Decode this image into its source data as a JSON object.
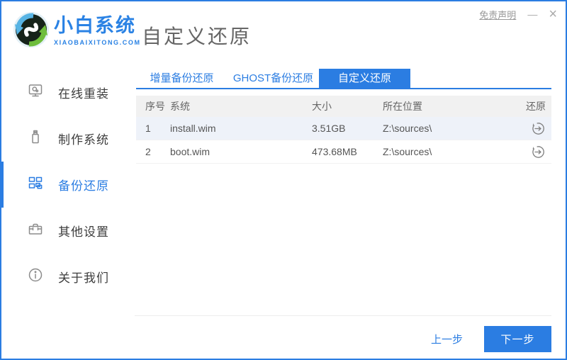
{
  "window": {
    "disclaimer_link": "免责声明",
    "minimize_label": "—",
    "close_label": "×",
    "accent_color": "#2b7de2"
  },
  "brand": {
    "name": "小白系统",
    "domain": "XIAOBAIXITONG.COM"
  },
  "header": {
    "title": "自定义还原"
  },
  "sidebar": {
    "items": [
      {
        "label": "在线重装",
        "icon": "monitor-icon",
        "active": false
      },
      {
        "label": "制作系统",
        "icon": "usb-drive-icon",
        "active": false
      },
      {
        "label": "备份还原",
        "icon": "backup-grid-icon",
        "active": true
      },
      {
        "label": "其他设置",
        "icon": "toolbox-icon",
        "active": false
      },
      {
        "label": "关于我们",
        "icon": "info-icon",
        "active": false
      }
    ]
  },
  "tabs": [
    {
      "label": "增量备份还原",
      "active": false
    },
    {
      "label": "GHOST备份还原",
      "active": false
    },
    {
      "label": "自定义还原",
      "active": true
    }
  ],
  "table": {
    "columns": [
      "序号",
      "系统",
      "大小",
      "所在位置",
      "还原"
    ],
    "rows": [
      {
        "index": "1",
        "system": "install.wim",
        "size": "3.51GB",
        "location": "Z:\\sources\\",
        "restore_icon": "restore-icon"
      },
      {
        "index": "2",
        "system": "boot.wim",
        "size": "473.68MB",
        "location": "Z:\\sources\\",
        "restore_icon": "restore-icon"
      }
    ]
  },
  "footer": {
    "prev_label": "上一步",
    "next_label": "下一步"
  }
}
